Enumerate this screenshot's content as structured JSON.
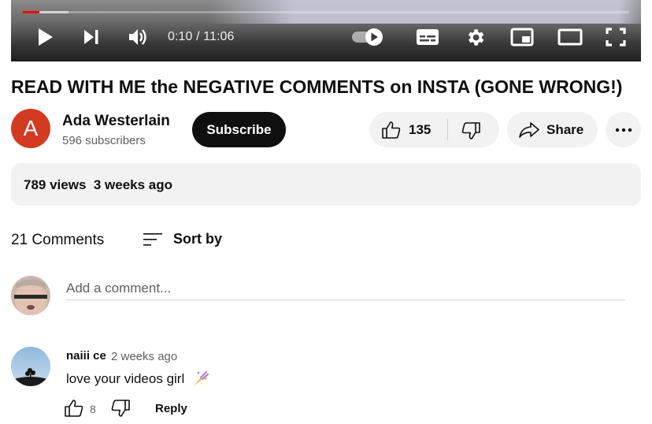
{
  "player": {
    "played_fraction": 0.027,
    "buffered_fraction": 0.075,
    "time_display": "0:10 / 11:06",
    "controls": [
      "play-icon",
      "next-icon",
      "volume-icon",
      "autoplay-toggle-icon",
      "subtitles-icon",
      "settings-gear-icon",
      "miniplayer-icon",
      "theater-mode-icon",
      "fullscreen-icon"
    ],
    "colors": {
      "progress": "#ff0000"
    }
  },
  "video": {
    "title": "READ WITH ME the NEGATIVE COMMENTS on INSTA (GONE WRONG!)"
  },
  "channel": {
    "avatar_letter": "A",
    "avatar_color": "#d33a22",
    "name": "Ada Westerlain",
    "subscribers": "596 subscribers",
    "subscribe_label": "Subscribe"
  },
  "actions": {
    "like_count": "135",
    "share_label": "Share"
  },
  "description": {
    "views": "789 views",
    "date": "3 weeks ago"
  },
  "comments_section": {
    "count_label": "21 Comments",
    "sort_label": "Sort by",
    "add_placeholder": "Add a comment...",
    "comments": [
      {
        "author": "naiii ce",
        "time": "2 weeks ago",
        "text": "love your videos girl",
        "emoji": "sparkle-emoji-icon",
        "likes": "8",
        "reply_label": "Reply"
      }
    ]
  }
}
